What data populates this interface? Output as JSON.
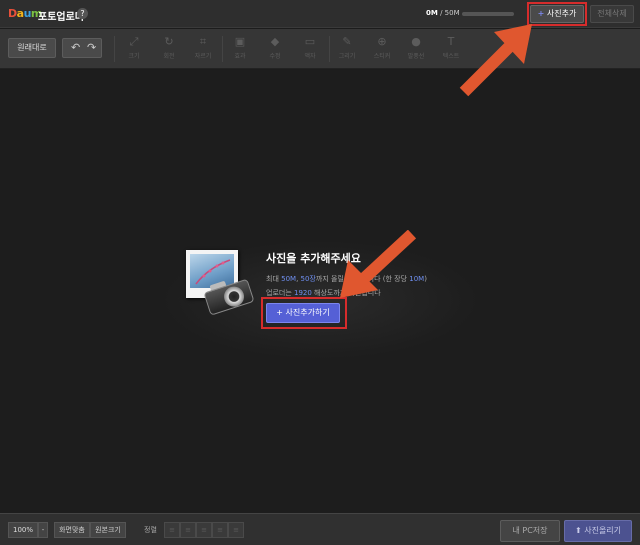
{
  "header": {
    "logo": {
      "d": "D",
      "a": "a",
      "u": "u",
      "m": "m"
    },
    "title": "포토업로더",
    "help": "?",
    "usage_current": "0M",
    "usage_total": "/ 50M",
    "add_photo_button": "사진추가",
    "add_photo_icon": "plus-icon",
    "delete_all_button": "전체삭제"
  },
  "toolbar": {
    "original_button": "원래대로",
    "undo_icon": "undo-icon",
    "redo_icon": "redo-icon",
    "tools": [
      {
        "label": "크기",
        "icon": "resize-icon"
      },
      {
        "label": "회전",
        "icon": "rotate-icon"
      },
      {
        "label": "자르기",
        "icon": "crop-icon"
      },
      {
        "label": "효과",
        "icon": "effect-icon"
      },
      {
        "label": "수정",
        "icon": "eraser-icon"
      },
      {
        "label": "액자",
        "icon": "frame-icon"
      },
      {
        "label": "그리기",
        "icon": "pen-icon"
      },
      {
        "label": "스티커",
        "icon": "sticker-icon"
      },
      {
        "label": "말풍선",
        "icon": "speech-bubble-icon"
      },
      {
        "label": "텍스트",
        "icon": "text-icon"
      }
    ]
  },
  "empty_state": {
    "title": "사진을 추가해주세요",
    "line1_a": "최대 ",
    "line1_b": "50M",
    "line1_c": ", ",
    "line1_d": "50장",
    "line1_e": "까지 올릴 수 있습니다 (한 장당 ",
    "line1_f": "10M",
    "line1_g": ")",
    "line2_a": "업로더는 ",
    "line2_b": "1920",
    "line2_c": " 해상도까지 지원합니다",
    "add_button": "사진추가하기"
  },
  "footer": {
    "zoom": "100%",
    "zoom_dropdown": "-",
    "fit_screen": "화면맞춤",
    "original_size": "원본크기",
    "align_label": "정렬",
    "save_pc": "내 PC저장",
    "upload": "사진올리기",
    "upload_icon": "up-arrow-icon"
  },
  "colors": {
    "accent": "#5560d6",
    "highlight": "#d62c2c",
    "annotation_arrow": "#e0572f"
  }
}
